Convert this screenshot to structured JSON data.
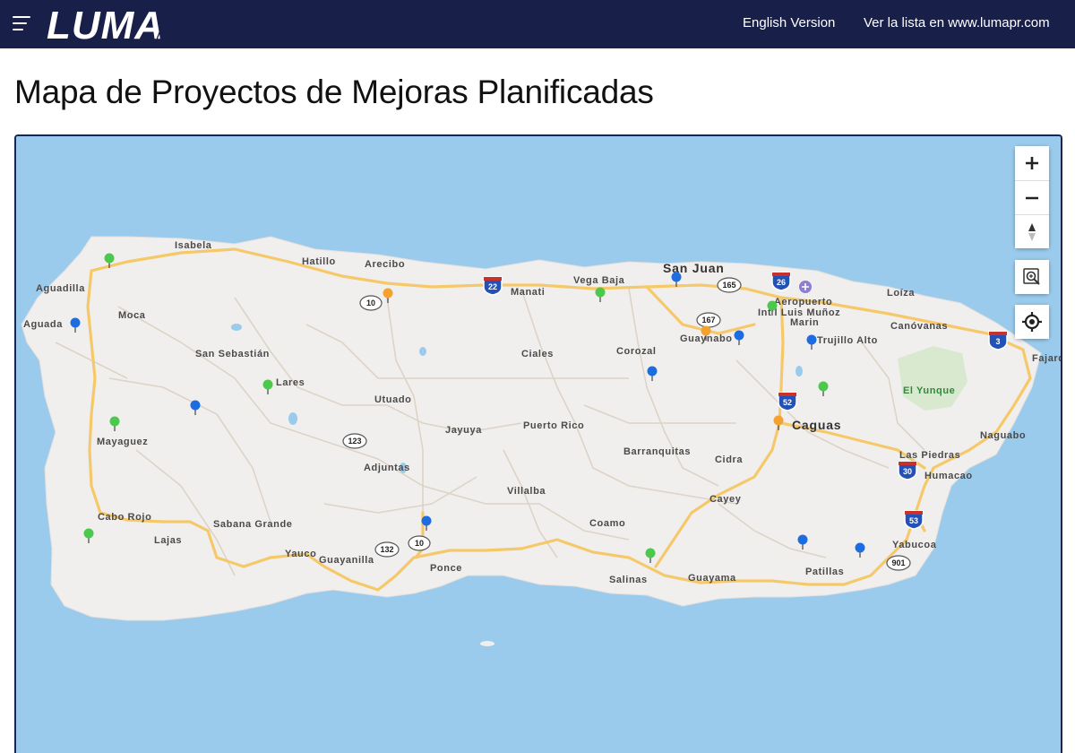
{
  "header": {
    "logo_text": "LUMA",
    "nav": [
      {
        "label": "English Version"
      },
      {
        "label": "Ver la lista en www.lumapr.com"
      }
    ]
  },
  "page": {
    "title": "Mapa de Proyectos de Mejoras Planificadas"
  },
  "map": {
    "places": [
      {
        "name": "Isabela"
      },
      {
        "name": "Hatillo"
      },
      {
        "name": "Arecibo"
      },
      {
        "name": "Aguadilla"
      },
      {
        "name": "Vega Baja"
      },
      {
        "name": "Manati"
      },
      {
        "name": "San Juan"
      },
      {
        "name": "Aeropuerto"
      },
      {
        "name": "Int'l Luis Muñoz"
      },
      {
        "name": "Marin"
      },
      {
        "name": "Loíza"
      },
      {
        "name": "Moca"
      },
      {
        "name": "Aguada"
      },
      {
        "name": "Guaynabo"
      },
      {
        "name": "Trujillo Alto"
      },
      {
        "name": "Canóvanas"
      },
      {
        "name": "Fajardo"
      },
      {
        "name": "San Sebastián"
      },
      {
        "name": "Ciales"
      },
      {
        "name": "Corozal"
      },
      {
        "name": "Lares"
      },
      {
        "name": "Utuado"
      },
      {
        "name": "El Yunque"
      },
      {
        "name": "Jayuya"
      },
      {
        "name": "Puerto Rico"
      },
      {
        "name": "Caguas"
      },
      {
        "name": "Naguabo"
      },
      {
        "name": "Mayaguez"
      },
      {
        "name": "Barranquitas"
      },
      {
        "name": "Cidra"
      },
      {
        "name": "Adjuntas"
      },
      {
        "name": "Las Piedras"
      },
      {
        "name": "Humacao"
      },
      {
        "name": "Villalba"
      },
      {
        "name": "Cayey"
      },
      {
        "name": "Cabo Rojo"
      },
      {
        "name": "Sabana Grande"
      },
      {
        "name": "Coamo"
      },
      {
        "name": "Lajas"
      },
      {
        "name": "Yauco"
      },
      {
        "name": "Guayanilla"
      },
      {
        "name": "Ponce"
      },
      {
        "name": "Yabucoa"
      },
      {
        "name": "Patillas"
      },
      {
        "name": "Salinas"
      },
      {
        "name": "Guayama"
      }
    ],
    "shields": [
      {
        "type": "interstate",
        "number": "22"
      },
      {
        "type": "interstate",
        "number": "26"
      },
      {
        "type": "interstate",
        "number": "3"
      },
      {
        "type": "interstate",
        "number": "52"
      },
      {
        "type": "interstate",
        "number": "30"
      },
      {
        "type": "interstate",
        "number": "53"
      },
      {
        "type": "route",
        "number": "10"
      },
      {
        "type": "route",
        "number": "165"
      },
      {
        "type": "route",
        "number": "167"
      },
      {
        "type": "route",
        "number": "123"
      },
      {
        "type": "route",
        "number": "132"
      },
      {
        "type": "route",
        "number": "10"
      },
      {
        "type": "route",
        "number": "901"
      }
    ],
    "markers": [
      {
        "color": "#4cc94c"
      },
      {
        "color": "#1e6de0"
      },
      {
        "color": "#f4a22d"
      },
      {
        "color": "#4cc94c"
      },
      {
        "color": "#1e6de0"
      },
      {
        "color": "#4cc94c"
      },
      {
        "color": "#f4a22d"
      },
      {
        "color": "#1e6de0"
      },
      {
        "color": "#1e6de0"
      },
      {
        "color": "#1e6de0"
      },
      {
        "color": "#4cc94c"
      },
      {
        "color": "#1e6de0"
      },
      {
        "color": "#4cc94c"
      },
      {
        "color": "#4cc94c"
      },
      {
        "color": "#f4a22d"
      },
      {
        "color": "#4cc94c"
      },
      {
        "color": "#1e6de0"
      },
      {
        "color": "#4cc94c"
      },
      {
        "color": "#1e6de0"
      },
      {
        "color": "#1e6de0"
      }
    ],
    "controls": {
      "zoom_in_icon": "plus-icon",
      "zoom_out_icon": "minus-icon",
      "compass_icon": "compass-icon",
      "zoom_extent_icon": "magnifier-box-icon",
      "locate_icon": "locate-icon"
    }
  },
  "colors": {
    "header_bg": "#18204a",
    "water": "#9bcbec",
    "land": "#f1efee",
    "roads": "#f5c96a",
    "marker_green": "#4cc94c",
    "marker_blue": "#1e6de0",
    "marker_orange": "#f4a22d"
  }
}
